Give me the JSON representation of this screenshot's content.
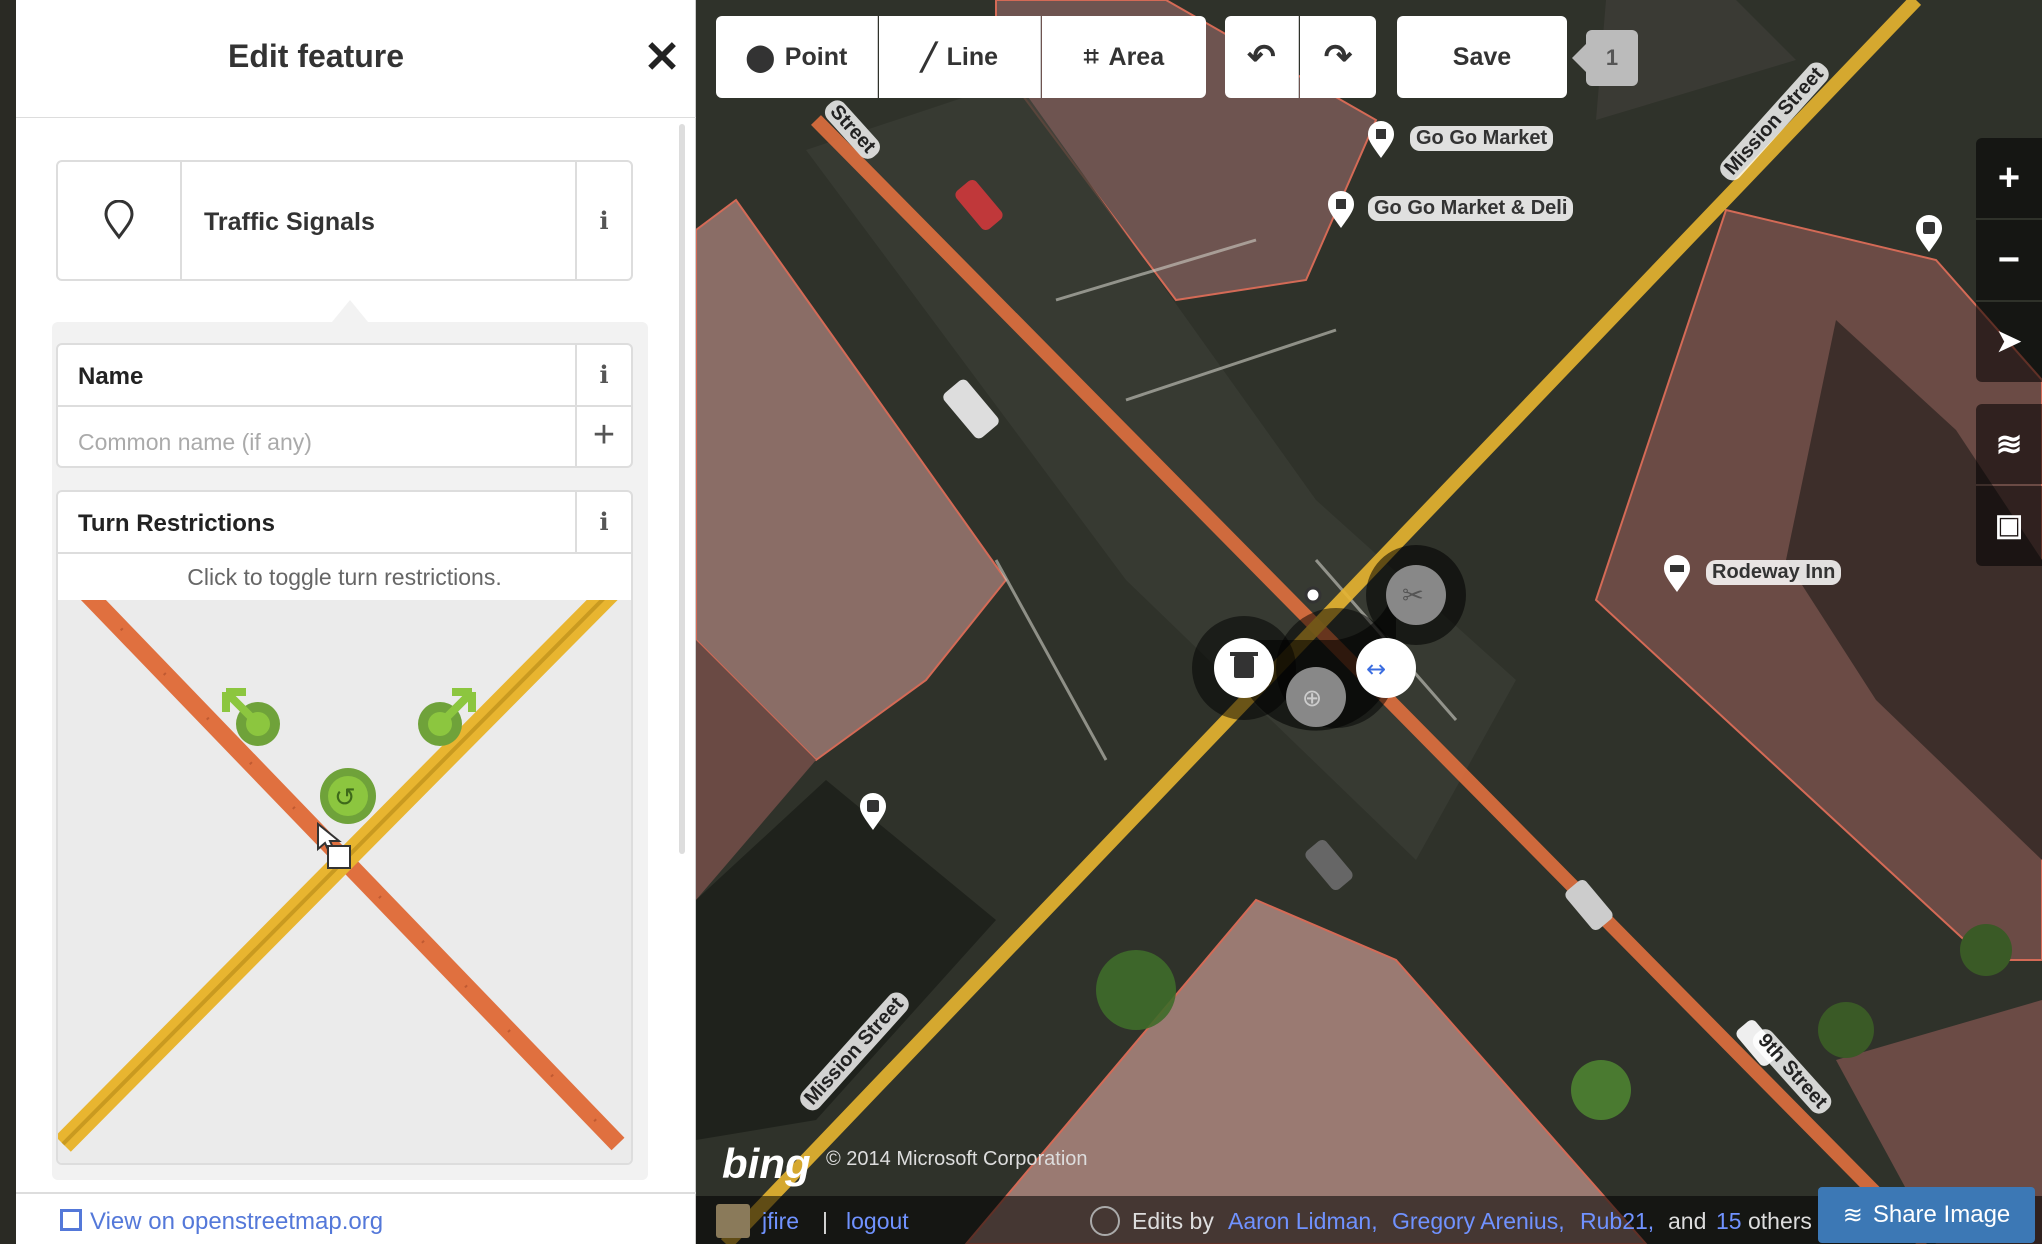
{
  "sidebar": {
    "title": "Edit feature",
    "close_glyph": "✕",
    "preset": {
      "icon": "pin-icon",
      "name": "Traffic Signals",
      "info": "i"
    },
    "fields": {
      "name": {
        "label": "Name",
        "info": "i",
        "placeholder": "Common name (if any)",
        "add": "+"
      },
      "turn": {
        "label": "Turn Restrictions",
        "info": "i",
        "hint": "Click to toggle turn restrictions."
      }
    },
    "osm_link": "View on openstreetmap.org"
  },
  "toolbar": {
    "point": "Point",
    "line": "Line",
    "area": "Area",
    "undo": "↶",
    "redo": "↷",
    "save": "Save",
    "edit_count": "1"
  },
  "map": {
    "controls": {
      "zoom_in": "+",
      "zoom_out": "−"
    },
    "labels": {
      "poi1": "Go Go Market",
      "poi2": "Go Go Market & Deli",
      "poi3": "Rodeway Inn",
      "street_mission_top": "Mission Street",
      "street_mission_bottom": "Mission Street",
      "street_9th": "9th Street",
      "street_top_left": "Street"
    },
    "attribution": {
      "bing": "bing",
      "copyright": "© 2014 Microsoft Corporation"
    },
    "footer": {
      "user": "jfire",
      "separator": "|",
      "logout": "logout",
      "edits_by": "Edits by",
      "contributor1": "Aaron Lidman,",
      "contributor2": "Gregory Arenius,",
      "contributor3": "Rub21,",
      "and": "and",
      "count": "15",
      "others": "others"
    },
    "share": "Share Image"
  },
  "colors": {
    "road_primary": "#e0703f",
    "road_secondary": "#e8b530",
    "accent": "#7092ff",
    "turn_ok": "#8cc63f"
  }
}
